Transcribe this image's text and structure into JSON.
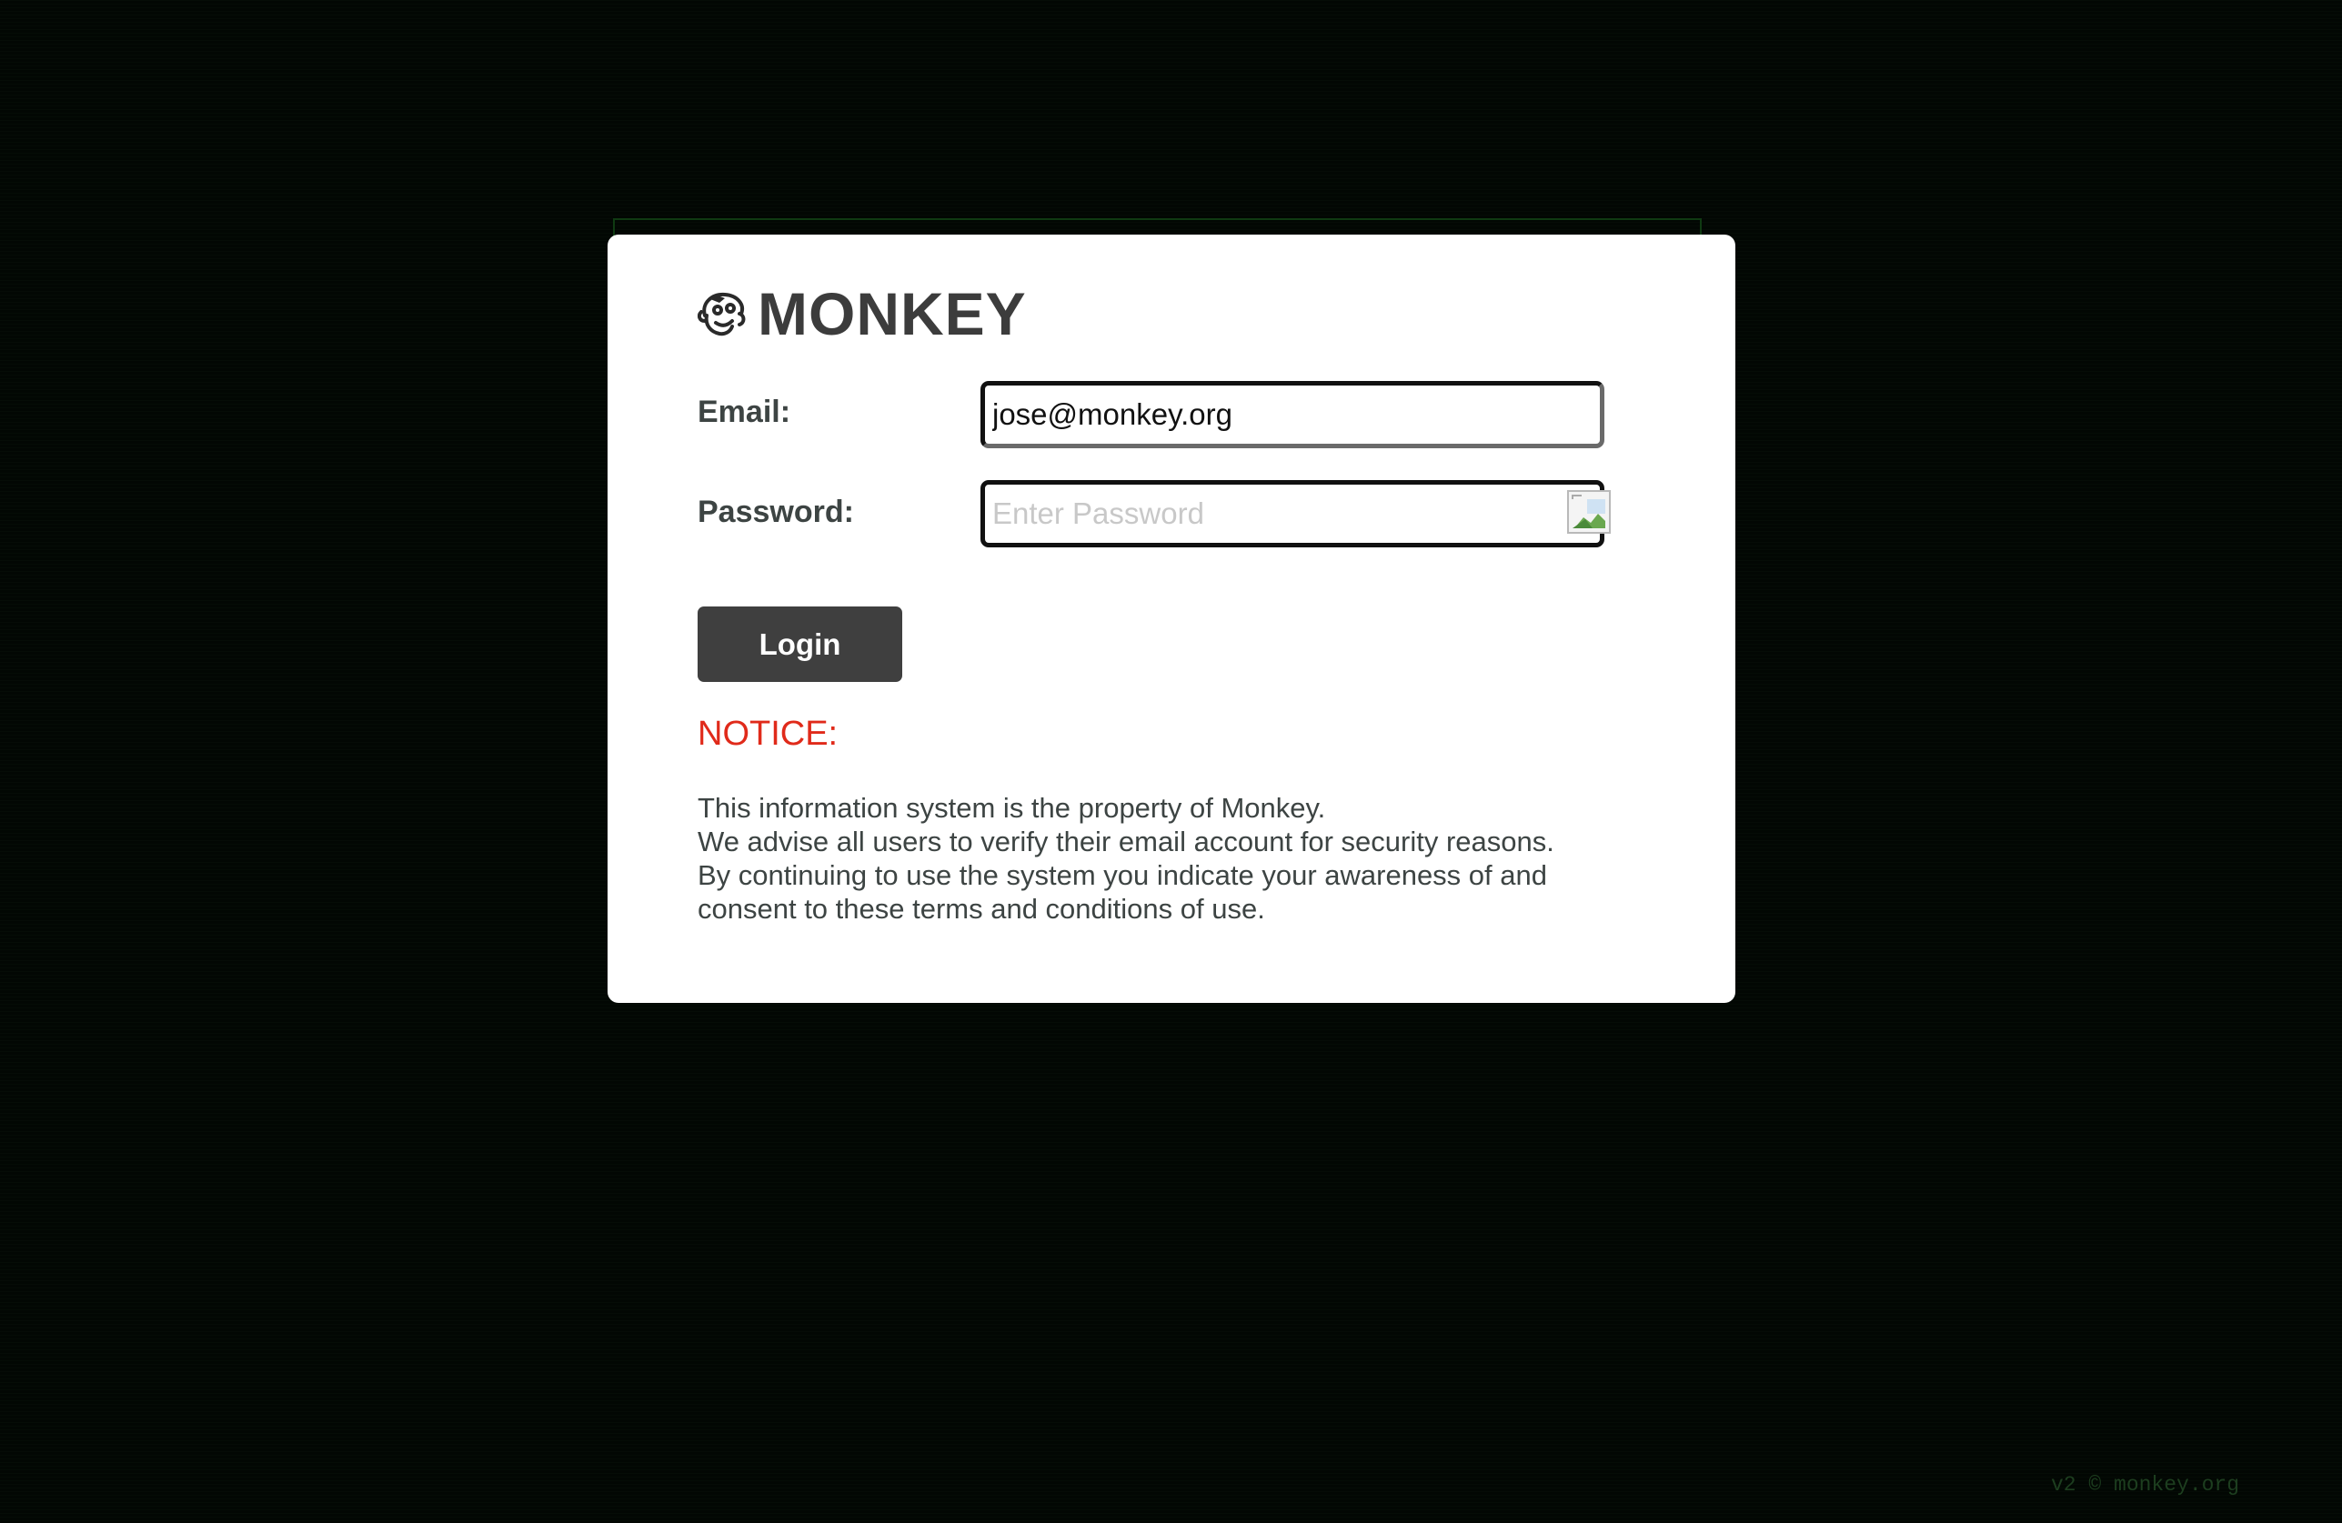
{
  "brand": {
    "name": "MONKEY",
    "logo_icon": "monkey-face-icon"
  },
  "form": {
    "email_label": "Email:",
    "email_value": "jose@monkey.org",
    "password_label": "Password:",
    "password_placeholder": "Enter Password",
    "password_value": "",
    "password_icon": "broken-image-icon",
    "login_label": "Login"
  },
  "notice": {
    "title": "NOTICE:",
    "lines": [
      "This information system is the property of Monkey.",
      "We advise all users to verify their email account for security reasons.",
      "By continuing to use the system you indicate your awareness of and",
      "consent to these terms and conditions of use."
    ]
  },
  "footer": {
    "text": "v2 © monkey.org"
  },
  "colors": {
    "background": "#020703",
    "card": "#ffffff",
    "button": "#3f3f3f",
    "notice": "#e02a1a",
    "text": "#3d4443"
  }
}
